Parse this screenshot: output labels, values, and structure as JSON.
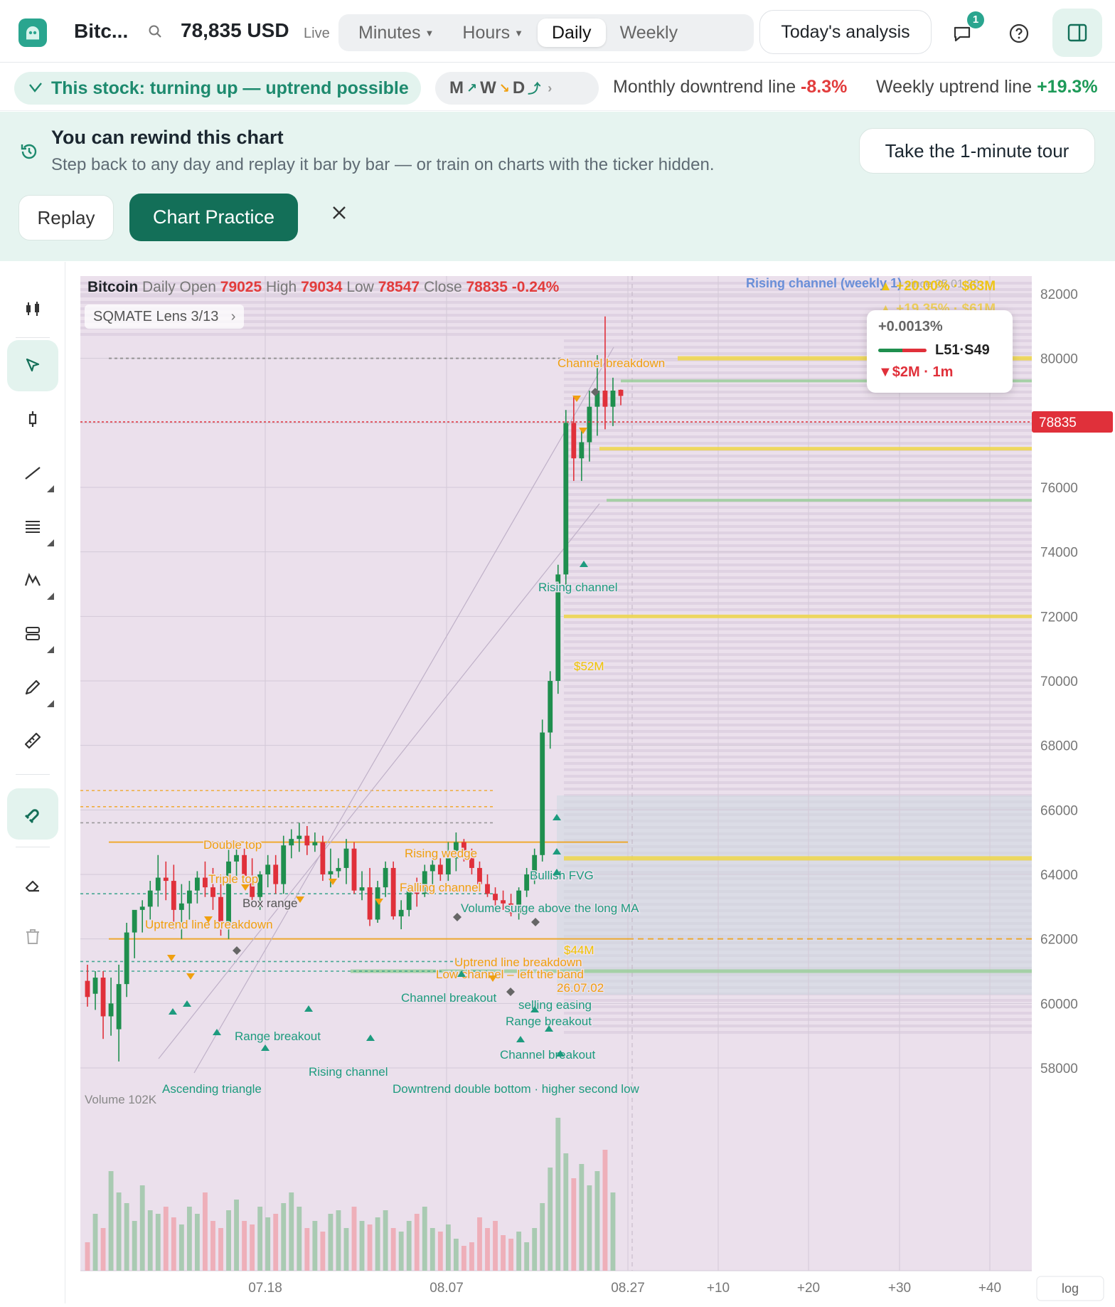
{
  "header": {
    "ticker": "Bitc...",
    "price": "78,835 USD",
    "live": "Live",
    "timeframes": [
      {
        "label": "Minutes",
        "caret": true,
        "active": false
      },
      {
        "label": "Hours",
        "caret": true,
        "active": false
      },
      {
        "label": "Daily",
        "caret": false,
        "active": true
      },
      {
        "label": "Weekly",
        "caret": false,
        "active": false
      }
    ],
    "analysis_label": "Today's analysis",
    "notif_count": "1"
  },
  "signals": {
    "trend": "This stock: turning up — uptrend possible",
    "mwd": [
      "M",
      "W",
      "D"
    ],
    "monthly_label": "Monthly downtrend line",
    "monthly_value": "-8.3%",
    "weekly_label": "Weekly uptrend line",
    "weekly_value": "+19.3%"
  },
  "banner": {
    "title": "You can rewind this chart",
    "subtitle": "Step back to any day and replay it bar by bar — or train on charts with the ticker hidden.",
    "tour_label": "Take the 1-minute tour",
    "replay_label": "Replay",
    "practice_label": "Chart Practice"
  },
  "tools": [
    "candles-icon",
    "cursor-icon",
    "crosshair-icon",
    "trendline-icon",
    "fib-icon",
    "pattern-icon",
    "measure-icon",
    "brush-icon",
    "ruler-icon",
    "magnet-icon",
    "eraser-icon",
    "trash-icon"
  ],
  "ohlc": {
    "name": "Bitcoin",
    "interval": "Daily",
    "open_label": "Open",
    "open": "79025",
    "high_label": "High",
    "high": "79034",
    "low_label": "Low",
    "low": "78547",
    "close_label": "Close",
    "close": "78835",
    "change": "-0.24%"
  },
  "lens": "SQMATE Lens  3/13",
  "channel_note": "Rising channel (weekly 1)",
  "channel_since": "since 25.01.20",
  "tooltip": {
    "pct": "+0.0013%",
    "ls": "L51·S49",
    "flow": "▼$2M · 1m"
  },
  "price_tag": "78835",
  "volume_label": "Volume 102K",
  "log_label": "log",
  "colors": {
    "up": "#1f8f4e",
    "down": "#e0303a",
    "accent": "#136f58",
    "annot_orange": "#f0a010",
    "annot_teal": "#1d9b7e"
  },
  "chart_data": {
    "type": "candlestick",
    "y_ticks": [
      82000,
      80000,
      78000,
      76000,
      74000,
      72000,
      70000,
      68000,
      66000,
      64000,
      62000,
      60000,
      58000
    ],
    "x_ticks": [
      "07.18",
      "08.07",
      "08.27",
      "+10",
      "+20",
      "+30",
      "+40"
    ],
    "ylim": [
      56500,
      83000
    ],
    "candles": [
      {
        "o": 60700,
        "h": 61200,
        "l": 59900,
        "c": 60200
      },
      {
        "o": 60300,
        "h": 61000,
        "l": 59800,
        "c": 60800
      },
      {
        "o": 60800,
        "h": 61000,
        "l": 58900,
        "c": 59600
      },
      {
        "o": 59600,
        "h": 60800,
        "l": 59000,
        "c": 60000
      },
      {
        "o": 59200,
        "h": 61200,
        "l": 58200,
        "c": 60600
      },
      {
        "o": 60600,
        "h": 62500,
        "l": 60200,
        "c": 62200
      },
      {
        "o": 62200,
        "h": 62800,
        "l": 61400,
        "c": 62900
      },
      {
        "o": 62900,
        "h": 63200,
        "l": 62200,
        "c": 63000
      },
      {
        "o": 63000,
        "h": 63800,
        "l": 62600,
        "c": 63500
      },
      {
        "o": 63500,
        "h": 64600,
        "l": 63000,
        "c": 63900
      },
      {
        "o": 63900,
        "h": 64400,
        "l": 63200,
        "c": 63800
      },
      {
        "o": 63800,
        "h": 64300,
        "l": 62300,
        "c": 62900
      },
      {
        "o": 62900,
        "h": 63700,
        "l": 62000,
        "c": 63100
      },
      {
        "o": 63100,
        "h": 63800,
        "l": 62600,
        "c": 63500
      },
      {
        "o": 63500,
        "h": 64100,
        "l": 63100,
        "c": 63900
      },
      {
        "o": 63900,
        "h": 64400,
        "l": 63300,
        "c": 63600
      },
      {
        "o": 63600,
        "h": 64200,
        "l": 62900,
        "c": 63300
      },
      {
        "o": 63300,
        "h": 63800,
        "l": 62100,
        "c": 62400
      },
      {
        "o": 62400,
        "h": 64800,
        "l": 62000,
        "c": 64400
      },
      {
        "o": 64400,
        "h": 65000,
        "l": 63800,
        "c": 64600
      },
      {
        "o": 64600,
        "h": 64800,
        "l": 63800,
        "c": 63900
      },
      {
        "o": 63900,
        "h": 64500,
        "l": 63100,
        "c": 63300
      },
      {
        "o": 63300,
        "h": 64100,
        "l": 62900,
        "c": 64000
      },
      {
        "o": 64000,
        "h": 64600,
        "l": 63600,
        "c": 64300
      },
      {
        "o": 64300,
        "h": 64600,
        "l": 63400,
        "c": 63700
      },
      {
        "o": 63700,
        "h": 65200,
        "l": 63400,
        "c": 64900
      },
      {
        "o": 64900,
        "h": 65400,
        "l": 64500,
        "c": 65100
      },
      {
        "o": 65100,
        "h": 65600,
        "l": 64700,
        "c": 65200
      },
      {
        "o": 65200,
        "h": 65500,
        "l": 64600,
        "c": 64900
      },
      {
        "o": 64900,
        "h": 65300,
        "l": 64700,
        "c": 65000
      },
      {
        "o": 65000,
        "h": 65200,
        "l": 63800,
        "c": 64000
      },
      {
        "o": 64000,
        "h": 64800,
        "l": 63600,
        "c": 64100
      },
      {
        "o": 64100,
        "h": 64500,
        "l": 63900,
        "c": 64200
      },
      {
        "o": 64200,
        "h": 65100,
        "l": 63700,
        "c": 64800
      },
      {
        "o": 64800,
        "h": 65000,
        "l": 63400,
        "c": 63500
      },
      {
        "o": 63500,
        "h": 64100,
        "l": 63200,
        "c": 63600
      },
      {
        "o": 63600,
        "h": 64200,
        "l": 62400,
        "c": 62600
      },
      {
        "o": 62600,
        "h": 63800,
        "l": 62500,
        "c": 63600
      },
      {
        "o": 63600,
        "h": 64400,
        "l": 63300,
        "c": 64200
      },
      {
        "o": 64200,
        "h": 64400,
        "l": 62600,
        "c": 62700
      },
      {
        "o": 62700,
        "h": 63200,
        "l": 62300,
        "c": 62900
      },
      {
        "o": 62900,
        "h": 63700,
        "l": 62700,
        "c": 63500
      },
      {
        "o": 63500,
        "h": 63900,
        "l": 63000,
        "c": 63400
      },
      {
        "o": 63400,
        "h": 64300,
        "l": 63300,
        "c": 64100
      },
      {
        "o": 64100,
        "h": 64500,
        "l": 63600,
        "c": 64300
      },
      {
        "o": 64300,
        "h": 64500,
        "l": 63800,
        "c": 64000
      },
      {
        "o": 64000,
        "h": 65000,
        "l": 63800,
        "c": 64500
      },
      {
        "o": 64500,
        "h": 65300,
        "l": 64100,
        "c": 65000
      },
      {
        "o": 65000,
        "h": 65100,
        "l": 64400,
        "c": 64500
      },
      {
        "o": 64500,
        "h": 64800,
        "l": 64000,
        "c": 64200
      },
      {
        "o": 64200,
        "h": 64400,
        "l": 63600,
        "c": 63700
      },
      {
        "o": 63700,
        "h": 64000,
        "l": 63300,
        "c": 63400
      },
      {
        "o": 63400,
        "h": 63600,
        "l": 63000,
        "c": 63200
      },
      {
        "o": 63200,
        "h": 63500,
        "l": 62900,
        "c": 63100
      },
      {
        "o": 63100,
        "h": 63400,
        "l": 62700,
        "c": 62800
      },
      {
        "o": 62800,
        "h": 63600,
        "l": 62600,
        "c": 63500
      },
      {
        "o": 63500,
        "h": 64200,
        "l": 63300,
        "c": 64000
      },
      {
        "o": 64000,
        "h": 64800,
        "l": 63700,
        "c": 64600
      },
      {
        "o": 64600,
        "h": 68800,
        "l": 64400,
        "c": 68400
      },
      {
        "o": 68400,
        "h": 70300,
        "l": 67900,
        "c": 70000
      },
      {
        "o": 70000,
        "h": 73600,
        "l": 69600,
        "c": 73300
      },
      {
        "o": 73300,
        "h": 78400,
        "l": 72900,
        "c": 78000
      },
      {
        "o": 78000,
        "h": 78800,
        "l": 76200,
        "c": 76900
      },
      {
        "o": 76900,
        "h": 77800,
        "l": 76200,
        "c": 77400
      },
      {
        "o": 77400,
        "h": 79000,
        "l": 76800,
        "c": 78500
      },
      {
        "o": 78500,
        "h": 80100,
        "l": 77600,
        "c": 79000
      },
      {
        "o": 79000,
        "h": 81300,
        "l": 77800,
        "c": 78500
      },
      {
        "o": 78500,
        "h": 79400,
        "l": 77900,
        "c": 79000
      },
      {
        "o": 79025,
        "h": 79034,
        "l": 78547,
        "c": 78835
      }
    ],
    "volume": [
      40,
      80,
      60,
      140,
      110,
      95,
      70,
      120,
      85,
      80,
      90,
      75,
      65,
      90,
      80,
      110,
      70,
      60,
      85,
      100,
      70,
      65,
      90,
      75,
      80,
      95,
      110,
      90,
      60,
      70,
      55,
      80,
      85,
      60,
      90,
      70,
      65,
      75,
      85,
      60,
      55,
      70,
      80,
      90,
      60,
      55,
      65,
      45,
      35,
      40,
      75,
      60,
      70,
      50,
      45,
      55,
      40,
      60,
      95,
      145,
      215,
      165,
      130,
      150,
      120,
      140,
      170,
      110
    ]
  },
  "annotations_orange": [
    "Double top",
    "Triple top",
    "Rising wedge",
    "Falling channel",
    "Uptrend line breakdown",
    "Channel breakdown",
    "Uptrend line breakdown",
    "Low channel – left the band",
    "26.07.02"
  ],
  "annotations_teal": [
    "Bullish FVG",
    "Volume surge above the long MA",
    "Channel breakout",
    "Range breakout",
    "Rising channel",
    "Ascending triangle",
    "Rising channel",
    "Range breakout",
    "Channel breakout",
    "Downtrend double bottom · higher second low",
    "selling easing"
  ],
  "annotations_gray": [
    "Box range"
  ],
  "flows": [
    "$52M",
    "$44M",
    "+20.00% · $63M",
    "+19.35% · $61M"
  ]
}
